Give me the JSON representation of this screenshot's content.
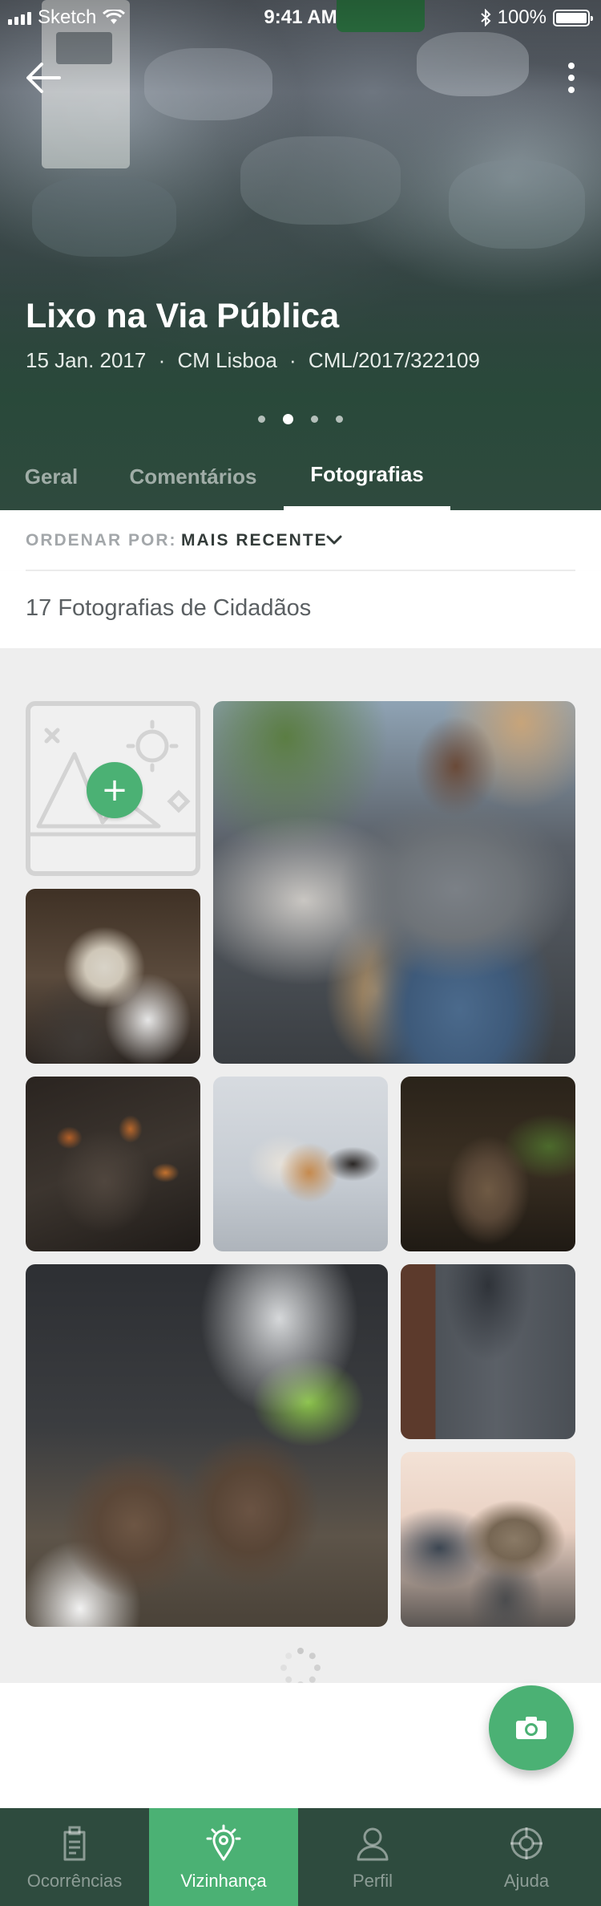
{
  "status_bar": {
    "carrier": "Sketch",
    "time": "9:41 AM",
    "battery": "100%"
  },
  "hero": {
    "title": "Lixo na Via Pública",
    "date": "15 Jan. 2017",
    "entity": "CM Lisboa",
    "reference": "CML/2017/322109",
    "separator": "·",
    "carousel": {
      "count": 4,
      "active_index": 1
    }
  },
  "tabs": [
    {
      "label": "Geral",
      "active": false
    },
    {
      "label": "Comentários",
      "active": false
    },
    {
      "label": "Fotografias",
      "active": true
    }
  ],
  "sort": {
    "label": "ORDENAR POR:",
    "value": "MAIS RECENTE"
  },
  "gallery": {
    "count_text": "17 Fotografias de Cidadãos",
    "add_icon": "plus-icon",
    "photos": [
      {
        "id": "dog"
      },
      {
        "id": "man"
      },
      {
        "id": "maggots"
      },
      {
        "id": "cat"
      },
      {
        "id": "rat"
      },
      {
        "id": "rats"
      },
      {
        "id": "bins"
      },
      {
        "id": "cat-on-bin"
      }
    ]
  },
  "fab": {
    "icon": "camera-icon"
  },
  "bottom_nav": [
    {
      "label": "Ocorrências",
      "icon": "document-icon",
      "active": false
    },
    {
      "label": "Vizinhança",
      "icon": "location-pin-icon",
      "active": true
    },
    {
      "label": "Perfil",
      "icon": "user-icon",
      "active": false
    },
    {
      "label": "Ajuda",
      "icon": "lifebuoy-icon",
      "active": false
    }
  ],
  "colors": {
    "accent": "#4bb174",
    "dark_green": "#2e4b3e",
    "background": "#eeeeee"
  }
}
